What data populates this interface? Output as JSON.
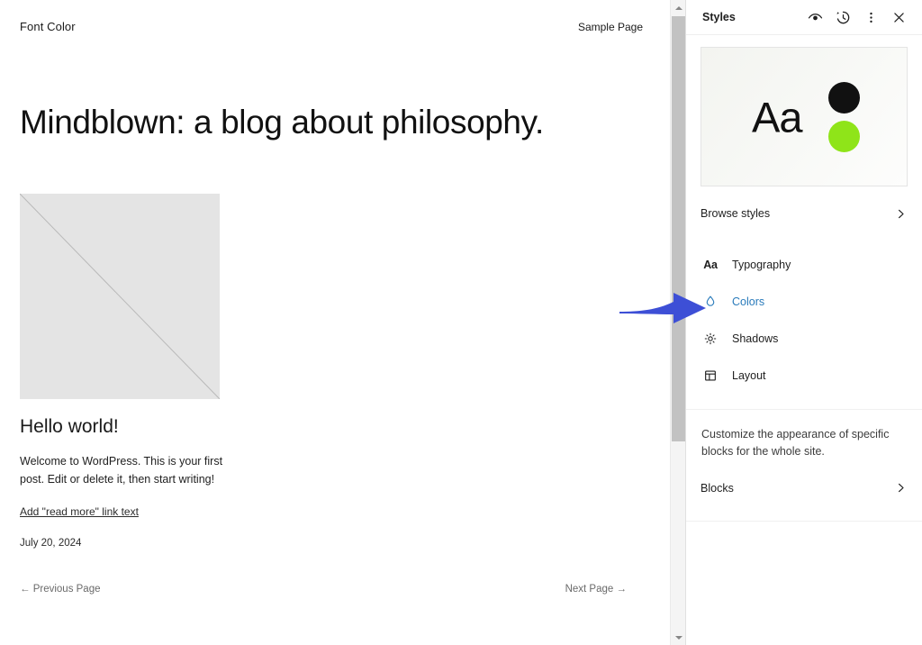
{
  "site": {
    "title": "Font Color",
    "nav_link": "Sample Page",
    "hero_heading": "Mindblown: a blog about philosophy.",
    "post": {
      "title": "Hello world!",
      "excerpt": "Welcome to WordPress. This is your first post. Edit or delete it, then start writing!",
      "read_more": "Add \"read more\" link text",
      "date": "July 20, 2024"
    },
    "pager": {
      "prev_arrow": "←",
      "prev_label": "Previous Page",
      "next_label": "Next Page",
      "next_arrow": "→"
    }
  },
  "sidebar": {
    "header": {
      "title": "Styles",
      "icons": [
        "eye-icon",
        "revisions-clock-icon",
        "more-options-icon",
        "close-icon"
      ]
    },
    "preview": {
      "sample_text": "Aa",
      "dot_colors": [
        "#111111",
        "#8FE419"
      ]
    },
    "browse_styles": {
      "label": "Browse styles",
      "chevron": "chevron-right-icon"
    },
    "menu": [
      {
        "label": "Typography",
        "icon": "typography-aa-icon",
        "active": false
      },
      {
        "label": "Colors",
        "icon": "color-droplet-icon",
        "active": true
      },
      {
        "label": "Shadows",
        "icon": "shadow-sun-icon",
        "active": false
      },
      {
        "label": "Layout",
        "icon": "layout-icon",
        "active": false
      }
    ],
    "blocks": {
      "description": "Customize the appearance of specific blocks for the whole site.",
      "label": "Blocks",
      "chevron": "chevron-right-icon"
    },
    "accent_color": "#2a7bbb"
  },
  "annotation": {
    "arrow_color": "#3d4fd6",
    "points_at": "Colors"
  },
  "scrollbar": {
    "up_arrow": "scroll-up-arrow",
    "down_arrow": "scroll-down-arrow"
  }
}
